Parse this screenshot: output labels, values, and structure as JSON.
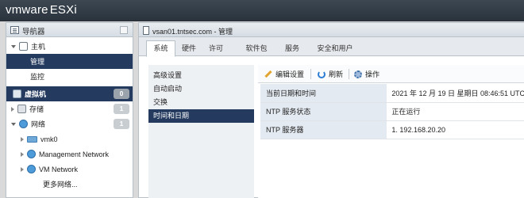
{
  "brand": {
    "logo": "vmware",
    "product": "ESXi"
  },
  "navigator": {
    "title": "导航器",
    "items": [
      {
        "label": "主机"
      },
      {
        "label": "管理"
      },
      {
        "label": "监控"
      },
      {
        "label": "虚拟机",
        "badge": "0"
      },
      {
        "label": "存储",
        "badge": "1"
      },
      {
        "label": "网络",
        "badge": "1"
      },
      {
        "label": "vmk0"
      },
      {
        "label": "Management Network"
      },
      {
        "label": "VM Network"
      },
      {
        "label": "更多网络..."
      }
    ]
  },
  "main": {
    "title": "vsan01.tntsec.com - 管理",
    "tabs": [
      {
        "label": "系统"
      },
      {
        "label": "硬件"
      },
      {
        "label": "许可"
      },
      {
        "label": "软件包"
      },
      {
        "label": "服务"
      },
      {
        "label": "安全和用户"
      }
    ],
    "sidebar": [
      {
        "label": "高级设置"
      },
      {
        "label": "自动启动"
      },
      {
        "label": "交换"
      },
      {
        "label": "时间和日期"
      }
    ],
    "toolbar": {
      "edit": "编辑设置",
      "refresh": "刷新",
      "actions": "操作"
    },
    "rows": [
      {
        "key": "当前日期和时间",
        "value": "2021 年 12 月 19 日 星期日 08:46:51 UTC"
      },
      {
        "key": "NTP 服务状态",
        "value": "正在运行"
      },
      {
        "key": "NTP 服务器",
        "value": "1. 192.168.20.20"
      }
    ]
  }
}
